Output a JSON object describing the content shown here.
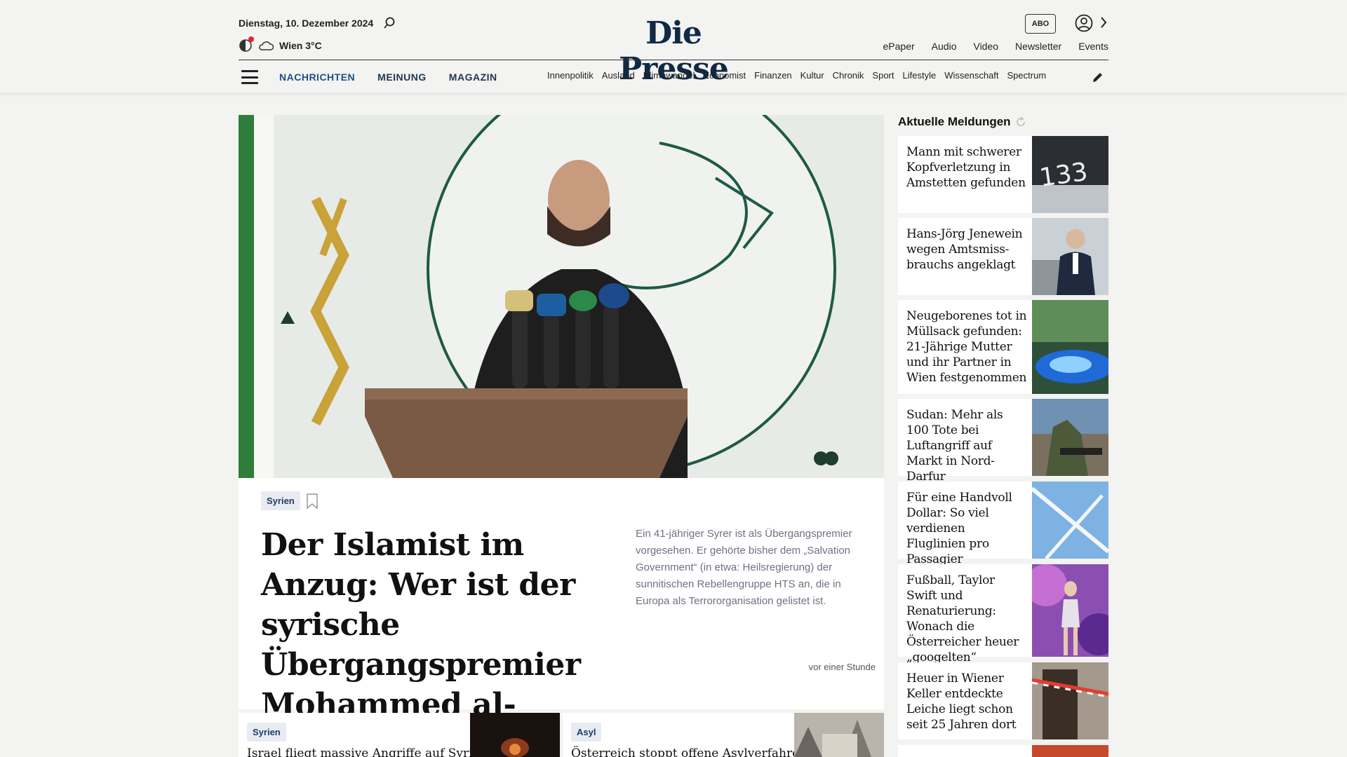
{
  "header": {
    "date": "Dienstag, 10. Dezember 2024",
    "weather": "Wien 3°C",
    "logo": "Die Presse",
    "abo": "ABO",
    "top_links": [
      "ePaper",
      "Audio",
      "Video",
      "Newsletter",
      "Events"
    ]
  },
  "nav": {
    "main": [
      "NACHRICHTEN",
      "MEINUNG",
      "MAGAZIN"
    ],
    "sub": [
      "Innenpolitik",
      "Ausland",
      "Klimawandel",
      "Economist",
      "Finanzen",
      "Kultur",
      "Chronik",
      "Sport",
      "Lifestyle",
      "Wissenschaft",
      "Spectrum"
    ]
  },
  "hero": {
    "tag": "Syrien",
    "title": "Der Islamist im Anzug: Wer ist der syrische Übergangspremier Mohammed al-Bashir?",
    "teaser": "Ein 41-jähriger Syrer ist als Übergangspremier vorgesehen. Er gehörte bisher dem „Salvation Government“ (in etwa: Heilsregierung) der sunnitischen Rebellengruppe HTS an, die in Europa als Terrororganisation gelistet ist.",
    "time": "vor einer Stunde"
  },
  "sidebar": {
    "title": "Aktuelle Meldungen",
    "items": [
      {
        "title": "Mann mit schwerer Kopfverletzung in Amstetten gefunden"
      },
      {
        "title": "Hans-Jörg Jenewein wegen Amtsmiss­brauchs angeklagt"
      },
      {
        "title": "Neugeborenes tot in Müllsack gefunden: 21-Jährige Mutter und ihr Partner in Wien festgenommen"
      },
      {
        "title": "Sudan: Mehr als 100 Tote bei Luftangriff auf Markt in Nord-Darfur"
      },
      {
        "title": "Für eine Handvoll Dollar: So viel verdienen Fluglinien pro Passagier"
      },
      {
        "title": "Fußball, Taylor Swift und Renaturierung: Wonach die Österreicher heuer „googelten“"
      },
      {
        "title": "Heuer in Wiener Keller entdeckte Leiche liegt schon seit 25 Jahren dort"
      }
    ]
  },
  "cards": [
    {
      "tag": "Syrien",
      "title": "Israel fliegt massive Angriffe auf Syrien:"
    },
    {
      "tag": "Asyl",
      "title": "Österreich stoppt offene Asylverfahren"
    }
  ],
  "colors": {
    "brand": "#102a43",
    "accent": "#1c4f8a",
    "alert": "#e3262b"
  }
}
